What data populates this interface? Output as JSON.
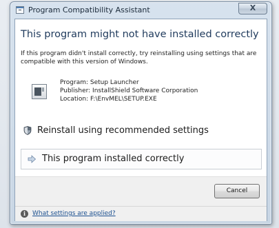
{
  "window": {
    "title": "Program Compatibility Assistant",
    "close_label": "X"
  },
  "main": {
    "heading": "This program might not have installed correctly",
    "description": "If this program didn't install correctly, try reinstalling using settings that are compatible with this version of Windows.",
    "program": {
      "icon": "setup-program-icon",
      "program_line": "Program: Setup Launcher",
      "publisher_line": "Publisher: InstallShield Software Corporation",
      "location_line": "Location: F:\\EnvMEL\\SETUP.EXE"
    },
    "options": [
      {
        "label": "Reinstall using recommended settings",
        "icon": "shield-icon"
      },
      {
        "label": "This program installed correctly",
        "icon": "arrow-icon"
      }
    ]
  },
  "footer": {
    "cancel_label": "Cancel",
    "help_link": "What settings are applied?",
    "help_icon": "info-icon"
  },
  "colors": {
    "heading": "#1f3a5c",
    "link": "#1b4f8f",
    "footer_bg": "#f0f0f0"
  }
}
